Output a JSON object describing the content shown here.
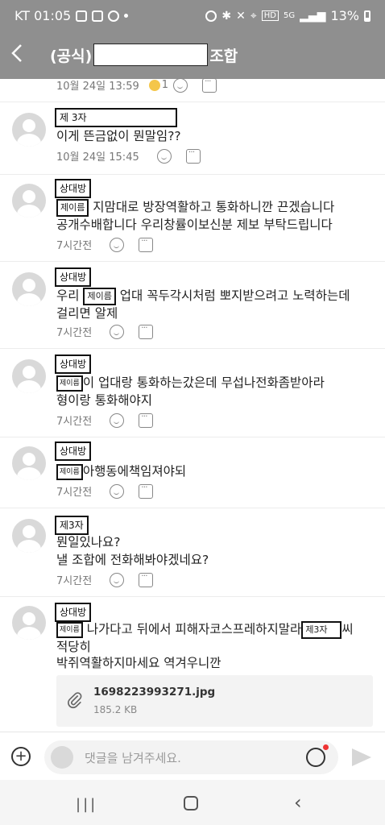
{
  "status": {
    "carrier_time": "KT 01:05",
    "battery": "13%",
    "net": "5G"
  },
  "header": {
    "title_prefix": "(공식)",
    "title_suffix": "조합"
  },
  "comments": [
    {
      "time": "10월 24일 13:59",
      "reaction_count": "1"
    },
    {
      "name": "제 3자",
      "line1": "이게 뜬금없이 뭔말임??",
      "time": "10월 24일 15:45"
    },
    {
      "name": "상대방",
      "tag": "제이름",
      "line1": " 지맘대로 방장역활하고 통화하니깐 끈겠습니다",
      "line2": "공개수배합니다 우리창률이보신분 제보 부탁드립니다",
      "time": "7시간전"
    },
    {
      "name": "상대방",
      "prefix": "우리 ",
      "tag": "제이름",
      "line1": " 업대 꼭두각시처럼 뽀지받으려고 노력하는데",
      "line2": "걸리면 알제",
      "time": "7시간전"
    },
    {
      "name": "상대방",
      "tag": "제이름",
      "line1": "이 업대랑 통화하는갔은데 무섭나전화좀받아라",
      "line2": "형이랑 통화해야지",
      "time": "7시간전"
    },
    {
      "name": "상대방",
      "tag": "제이름",
      "line1": "아행동에책임져야되",
      "time": "7시간전"
    },
    {
      "name": "제3자",
      "line1": "뭔일있나요?",
      "line2": "낼 조합에 전화해봐야겠네요?",
      "time": "7시간전"
    },
    {
      "name": "상대방",
      "tag": "제이름",
      "line1": " 나가다고 뒤에서 피해자코스프레하지말라",
      "tag2": "제3자",
      "line1_end": "씨",
      "line2": "적당히",
      "line3": "박쥐역활하지마세요 역겨우니깐"
    }
  ],
  "attachment": {
    "filename": "1698223993271.jpg",
    "size": "185.2 KB"
  },
  "composer": {
    "placeholder": "댓글을 남겨주세요."
  }
}
